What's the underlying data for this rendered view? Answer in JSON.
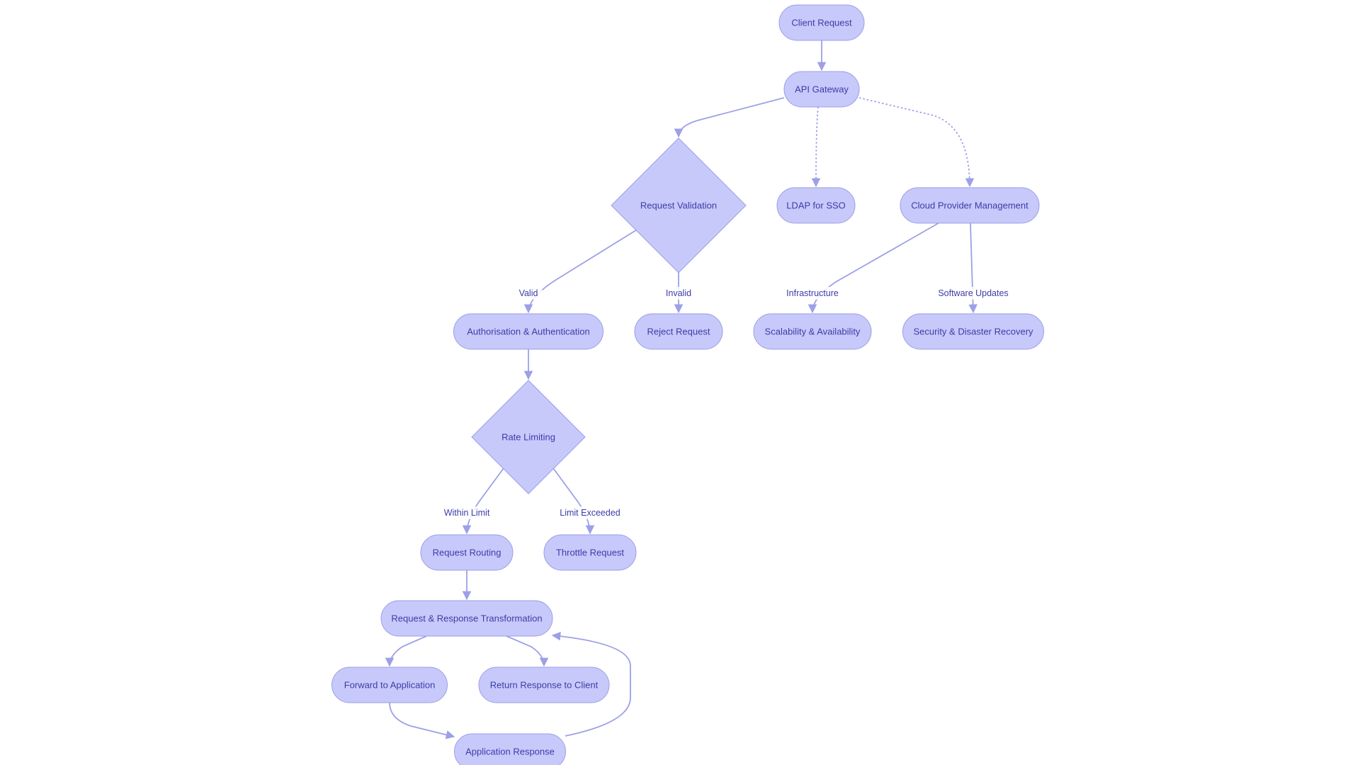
{
  "diagram": {
    "type": "flowchart",
    "colors": {
      "node_fill": "#c7c9fa",
      "node_stroke": "#9b9ee6",
      "edge": "#9da0e6",
      "text": "#3c3ca8",
      "background": "#ffffff"
    },
    "nodes": [
      {
        "id": "client_request",
        "label": "Client Request",
        "shape": "pill"
      },
      {
        "id": "api_gateway",
        "label": "API Gateway",
        "shape": "pill"
      },
      {
        "id": "request_validation",
        "label": "Request Validation",
        "shape": "diamond"
      },
      {
        "id": "ldap_sso",
        "label": "LDAP for SSO",
        "shape": "pill"
      },
      {
        "id": "cloud_provider",
        "label": "Cloud Provider Management",
        "shape": "pill"
      },
      {
        "id": "auth",
        "label": "Authorisation & Authentication",
        "shape": "pill"
      },
      {
        "id": "reject_request",
        "label": "Reject Request",
        "shape": "pill"
      },
      {
        "id": "scalability",
        "label": "Scalability & Availability",
        "shape": "pill"
      },
      {
        "id": "security_dr",
        "label": "Security & Disaster Recovery",
        "shape": "pill"
      },
      {
        "id": "rate_limiting",
        "label": "Rate Limiting",
        "shape": "diamond"
      },
      {
        "id": "request_routing",
        "label": "Request Routing",
        "shape": "pill"
      },
      {
        "id": "throttle_request",
        "label": "Throttle Request",
        "shape": "pill"
      },
      {
        "id": "transformation",
        "label": "Request & Response Transformation",
        "shape": "pill"
      },
      {
        "id": "forward_app",
        "label": "Forward to Application",
        "shape": "pill"
      },
      {
        "id": "return_response",
        "label": "Return Response to Client",
        "shape": "pill"
      },
      {
        "id": "app_response",
        "label": "Application Response",
        "shape": "pill"
      }
    ],
    "edges": [
      {
        "from": "client_request",
        "to": "api_gateway",
        "label": "",
        "style": "solid"
      },
      {
        "from": "api_gateway",
        "to": "request_validation",
        "label": "",
        "style": "solid"
      },
      {
        "from": "api_gateway",
        "to": "ldap_sso",
        "label": "",
        "style": "dotted"
      },
      {
        "from": "api_gateway",
        "to": "cloud_provider",
        "label": "",
        "style": "dotted"
      },
      {
        "from": "request_validation",
        "to": "auth",
        "label": "Valid",
        "style": "solid"
      },
      {
        "from": "request_validation",
        "to": "reject_request",
        "label": "Invalid",
        "style": "solid"
      },
      {
        "from": "cloud_provider",
        "to": "scalability",
        "label": "Infrastructure",
        "style": "solid"
      },
      {
        "from": "cloud_provider",
        "to": "security_dr",
        "label": "Software Updates",
        "style": "solid"
      },
      {
        "from": "auth",
        "to": "rate_limiting",
        "label": "",
        "style": "solid"
      },
      {
        "from": "rate_limiting",
        "to": "request_routing",
        "label": "Within Limit",
        "style": "solid"
      },
      {
        "from": "rate_limiting",
        "to": "throttle_request",
        "label": "Limit Exceeded",
        "style": "solid"
      },
      {
        "from": "request_routing",
        "to": "transformation",
        "label": "",
        "style": "solid"
      },
      {
        "from": "transformation",
        "to": "forward_app",
        "label": "",
        "style": "solid"
      },
      {
        "from": "transformation",
        "to": "return_response",
        "label": "",
        "style": "solid"
      },
      {
        "from": "forward_app",
        "to": "app_response",
        "label": "",
        "style": "solid"
      },
      {
        "from": "app_response",
        "to": "transformation",
        "label": "",
        "style": "solid"
      }
    ]
  }
}
